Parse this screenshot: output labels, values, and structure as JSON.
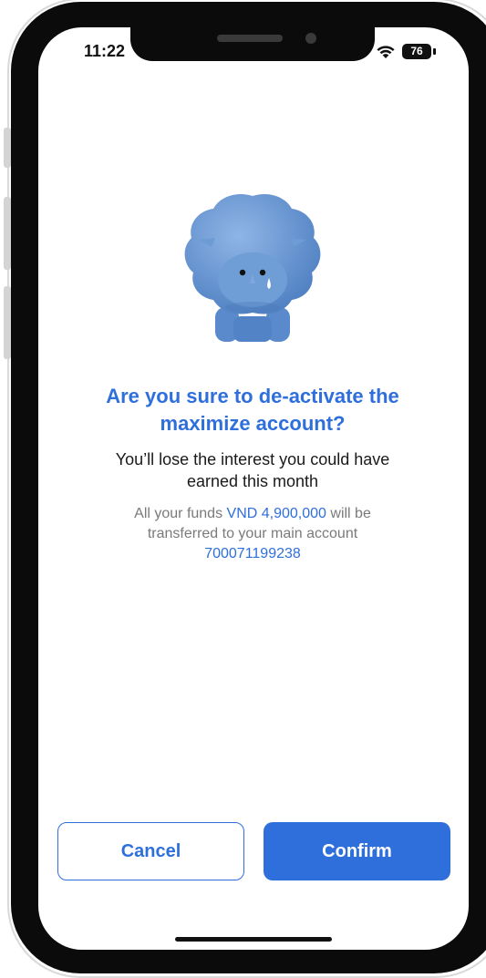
{
  "status_bar": {
    "time": "11:22",
    "battery": "76"
  },
  "dialog": {
    "title_line1": "Are you sure to de-activate the",
    "title_line2": "maximize account?",
    "subtitle_line1": "You’ll lose the interest you could have",
    "subtitle_line2": "earned this month",
    "info_prefix": "All your funds ",
    "amount": "VND 4,900,000",
    "info_suffix": " will be",
    "info_line2": "transferred to your main account",
    "account_number": "700071199238"
  },
  "actions": {
    "cancel_label": "Cancel",
    "confirm_label": "Confirm"
  },
  "colors": {
    "accent": "#2f6fdc",
    "mascot": "#6d9bd4"
  },
  "icons": [
    "wifi-icon",
    "battery-icon",
    "sad-rhino-mascot"
  ]
}
